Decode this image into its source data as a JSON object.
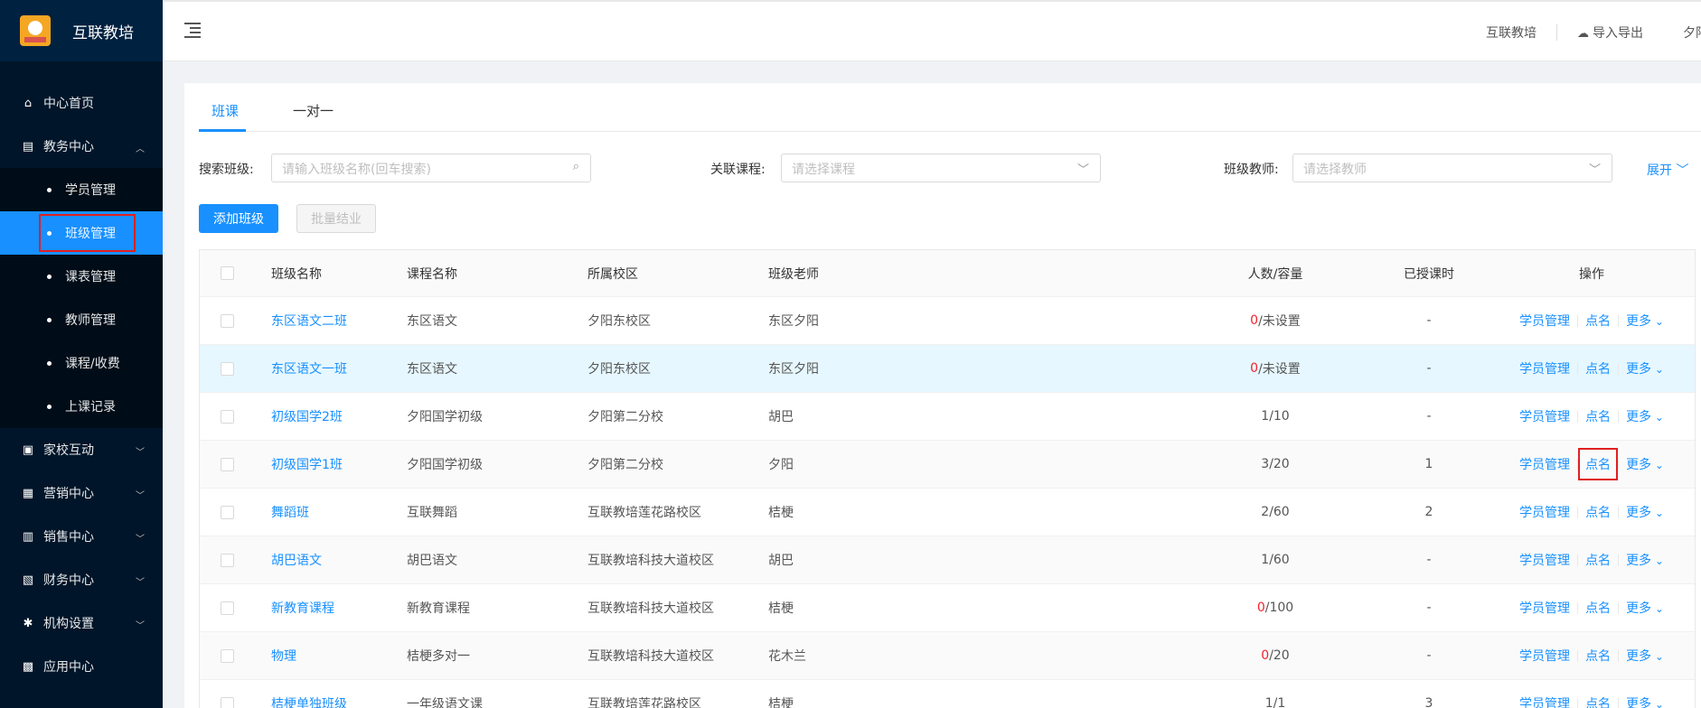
{
  "sidebar": {
    "brand": "互联教培",
    "items": [
      {
        "label": "中心首页",
        "icon": "home-icon",
        "glyph": "⌂"
      },
      {
        "label": "教务中心",
        "icon": "book-icon",
        "glyph": "▤",
        "expanded": true
      }
    ],
    "sub_items": [
      {
        "label": "学员管理"
      },
      {
        "label": "班级管理",
        "active": true
      },
      {
        "label": "课表管理"
      },
      {
        "label": "教师管理"
      },
      {
        "label": "课程/收费"
      },
      {
        "label": "上课记录"
      }
    ],
    "more_items": [
      {
        "label": "家校互动",
        "icon": "school-icon",
        "glyph": "▣"
      },
      {
        "label": "营销中心",
        "icon": "bag-icon",
        "glyph": "▦"
      },
      {
        "label": "销售中心",
        "icon": "chart-icon",
        "glyph": "▥"
      },
      {
        "label": "财务中心",
        "icon": "wallet-icon",
        "glyph": "▧"
      },
      {
        "label": "机构设置",
        "icon": "gear-icon",
        "glyph": "✱"
      },
      {
        "label": "应用中心",
        "icon": "apps-icon",
        "glyph": "▩"
      }
    ]
  },
  "header": {
    "org": "互联教培",
    "import_export": "导入导出",
    "user": "夕阳"
  },
  "tabs": [
    "班课",
    "一对一"
  ],
  "filters": {
    "class_label": "搜索班级:",
    "class_placeholder": "请输入班级名称(回车搜索)",
    "course_label": "关联课程:",
    "course_placeholder": "请选择课程",
    "teacher_label": "班级教师:",
    "teacher_placeholder": "请选择教师",
    "expand": "展开"
  },
  "actions": {
    "add": "添加班级",
    "batch": "批量结业"
  },
  "table": {
    "columns": [
      "班级名称",
      "课程名称",
      "所属校区",
      "班级老师",
      "人数/容量",
      "已授课时",
      "操作"
    ],
    "op_labels": {
      "students": "学员管理",
      "rollcall": "点名",
      "more": "更多"
    },
    "rows": [
      {
        "name": "东区语文二班",
        "course": "东区语文",
        "campus": "夕阳东校区",
        "teacher": "东区夕阳",
        "count": "0",
        "capacity": " /未设置",
        "hours": "-"
      },
      {
        "name": "东区语文一班",
        "course": "东区语文",
        "campus": "夕阳东校区",
        "teacher": "东区夕阳",
        "count": "0",
        "capacity": " /未设置",
        "hours": "-"
      },
      {
        "name": "初级国学2班",
        "course": "夕阳国学初级",
        "campus": "夕阳第二分校",
        "teacher": "胡巴",
        "count": "1",
        "capacity": " /10",
        "hours": "-"
      },
      {
        "name": "初级国学1班",
        "course": "夕阳国学初级",
        "campus": "夕阳第二分校",
        "teacher": "夕阳",
        "count": "3",
        "capacity": " /20",
        "hours": "1"
      },
      {
        "name": "舞蹈班",
        "course": "互联舞蹈",
        "campus": "互联教培莲花路校区",
        "teacher": "桔梗",
        "count": "2",
        "capacity": " /60",
        "hours": "2"
      },
      {
        "name": "胡巴语文",
        "course": "胡巴语文",
        "campus": "互联教培科技大道校区",
        "teacher": "胡巴",
        "count": "1",
        "capacity": " /60",
        "hours": "-"
      },
      {
        "name": "新教育课程",
        "course": "新教育课程",
        "campus": "互联教培科技大道校区",
        "teacher": "桔梗",
        "count": "0",
        "capacity": " /100",
        "hours": "-"
      },
      {
        "name": "物理",
        "course": "桔梗多对一",
        "campus": "互联教培科技大道校区",
        "teacher": "花木兰",
        "count": "0",
        "capacity": " /20",
        "hours": "-"
      },
      {
        "name": "桔梗单独班级",
        "course": "一年级语文课",
        "campus": "互联教培莲花路校区",
        "teacher": "桔梗",
        "count": "1",
        "capacity": " /1",
        "hours": "3"
      }
    ]
  }
}
